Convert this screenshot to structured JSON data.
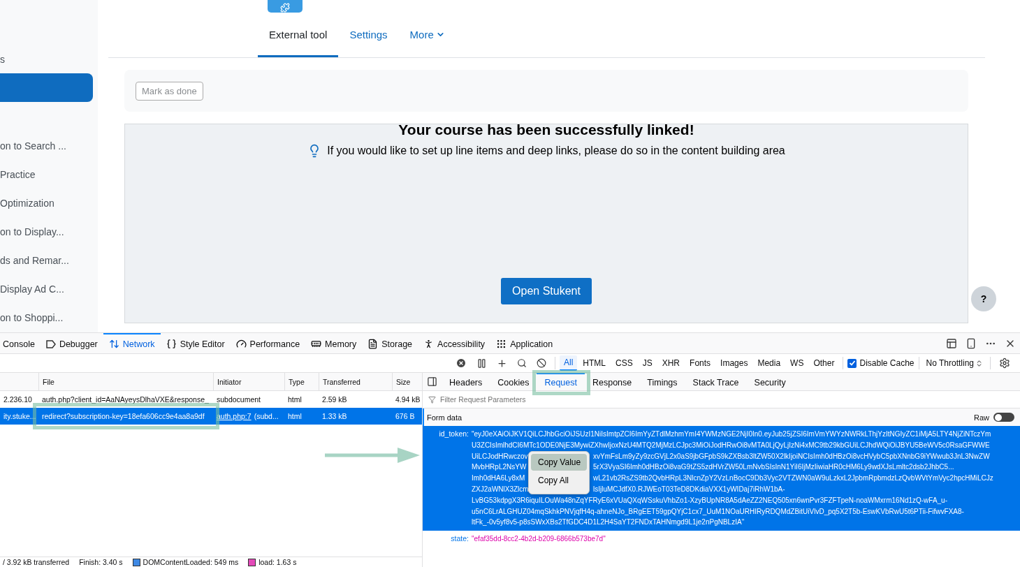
{
  "sidebar": {
    "items": [
      {
        "label": "s",
        "selected": false
      },
      {
        "selected": true
      },
      {
        "label": "on to Search ...",
        "selected": false
      },
      {
        "label": "Practice",
        "selected": false
      },
      {
        "label": "Optimization",
        "selected": false
      },
      {
        "label": "on to Display...",
        "selected": false
      },
      {
        "label": "ds and Remar...",
        "selected": false
      },
      {
        "label": "Display Ad C...",
        "selected": false
      },
      {
        "label": "on to Shoppi...",
        "selected": false
      }
    ]
  },
  "activity_tabs": [
    {
      "label": "External tool",
      "selected": true,
      "kind": "link"
    },
    {
      "label": "Settings",
      "selected": false,
      "kind": "link"
    },
    {
      "label": "More",
      "selected": false,
      "kind": "dropdown"
    }
  ],
  "completion": {
    "button": "Mark as done"
  },
  "tool_content": {
    "title": "Your course has been successfully linked!",
    "hint": "If you would like to set up line items and deep links, please do so in the content building area",
    "button": "Open Stukent"
  },
  "help_button": "?",
  "devtools": {
    "tabs": [
      {
        "label": "Console",
        "selected": false
      },
      {
        "label": "Debugger",
        "selected": false
      },
      {
        "label": "Network",
        "selected": true
      },
      {
        "label": "Style Editor",
        "selected": false
      },
      {
        "label": "Performance",
        "selected": false
      },
      {
        "label": "Memory",
        "selected": false
      },
      {
        "label": "Storage",
        "selected": false
      },
      {
        "label": "Accessibility",
        "selected": false
      },
      {
        "label": "Application",
        "selected": false
      }
    ],
    "filters": [
      {
        "label": "All",
        "selected": true
      },
      {
        "label": "HTML",
        "selected": false
      },
      {
        "label": "CSS",
        "selected": false
      },
      {
        "label": "JS",
        "selected": false
      },
      {
        "label": "XHR",
        "selected": false
      },
      {
        "label": "Fonts",
        "selected": false
      },
      {
        "label": "Images",
        "selected": false
      },
      {
        "label": "Media",
        "selected": false
      },
      {
        "label": "WS",
        "selected": false
      },
      {
        "label": "Other",
        "selected": false
      }
    ],
    "disable_cache": {
      "label": "Disable Cache",
      "checked": true
    },
    "throttling": "No Throttling",
    "columns": [
      "File",
      "Initiator",
      "Type",
      "Transferred",
      "Size"
    ],
    "requests": [
      {
        "host": "2.236.10",
        "file": "auth.php?client_id=AaNAyeysDlhaVXE&response_",
        "initiator": "subdocument",
        "type": "html",
        "transferred": "2.59 kB",
        "size": "4.94 kB",
        "selected": false
      },
      {
        "host": "ity.stuke...",
        "file": "redirect?subscription-key=18efa606cc9e4aa8a9df",
        "initiator_link": "auth.php:7",
        "initiator": "(subd...",
        "type": "html",
        "transferred": "1.33 kB",
        "size": "676 B",
        "selected": true,
        "highlighted": true
      }
    ],
    "status": [
      {
        "text": "/ 3.92 kB transferred"
      },
      {
        "text": "Finish: 3.40 s"
      },
      {
        "text": "DOMContentLoaded: 549 ms",
        "color": "#3f89e4"
      },
      {
        "text": "load: 1.63 s",
        "color": "#e44ab9"
      }
    ],
    "detail_tabs": [
      {
        "label": "Headers",
        "selected": false,
        "highlighted": false
      },
      {
        "label": "Cookies",
        "selected": false,
        "highlighted": false
      },
      {
        "label": "Request",
        "selected": true,
        "highlighted": true
      },
      {
        "label": "Response",
        "selected": false,
        "highlighted": false
      },
      {
        "label": "Timings",
        "selected": false,
        "highlighted": false
      },
      {
        "label": "Stack Trace",
        "selected": false,
        "highlighted": false
      },
      {
        "label": "Security",
        "selected": false,
        "highlighted": false
      }
    ],
    "filter_placeholder": "Filter Request Parameters",
    "section": "Form data",
    "raw_toggle": {
      "label": "Raw",
      "on": false
    },
    "params": [
      {
        "name": "id_token:",
        "selected": true,
        "lines": [
          [
            "\"eyJ0eXAiOiJKV1QiLCJhbGciOiJSUzI1NiIsImtpZCI6ImYyZTdlMzhmYmI4YWMzNGE2NjI0In0.eyJub25jZSI6ImVmYWYzNWRkLThjYzItNGIyZC1iMjA5LTY4NjZiNTczYm"
          ],
          [
            "U3ZCIsImlhdCI6MTc1ODE0NjE3MywiZXhwIjoxNzU4MTQ2MjMzLCJpc3MiOiJodHRwOi8vMTA0LjQyLjIzNi4xMC9tb29kbGUiLCJhdWQiOiJBYU5BeWV5c0RsaGFWWE"
          ],
          [
            "UiLCJodHRwczov",
            "xvYmFsLm9yZy9zcGVjL2x0aS9jbGFpbS9kZXBsb3ltZW50X2lkIjoiNCIsImh0dHBzOi8vcHVybC5pbXNnbG9iYWwub3JnL3NwZW"
          ],
          [
            "MvbHRpL2NsYW",
            "5rX3VyaSI6Imh0dHBzOi8vaG9tZS5zdHVrZW50LmNvbSIsInN1YiI6IjMzIiwiaHR0cHM6Ly9wdXJsLmltc2dsb2JhbC5..."
          ],
          [
            "Imh0dHA6Ly8xM",
            "wL21vb2RsZS9tb2QvbHRpL3NlcnZpY2VzLnBocC9Db3Vyc2VTZWN0aW9uLzkxL2JpbmRpbmdzLzQvbWVtYmVyc2hpcHMiLCJz"
          ],
          [
            "ZXJ2aWNlX3Zlcm",
            "lsIjluMCJdfX0.RJWEoT03TeD8DKdiaVXX1yWIDaj7iRhW1bA-"
          ],
          [
            "LvBG53kdpgX3R6iquILOuWa48nZqYFRyE6xVUaQXqWSskuVhbZo1-XzyBUpNR8A5dAeZZ2NEQ505xn6wnPvr3FZFTpeN-noaWMxrm16Nd1zQ-wFA_u-"
          ],
          [
            "u5nC6LrALGHUZ04mqSkhkPNVjqfH4q-ahneNJo_BRgEET59gpQYjC1cx7_UuM1NOaURHIRyRDQMdZBitUiVlvD_pq5X2T5b-EswKVbRwU5t6PTii-FifwvFXA8-"
          ],
          [
            "ltFk_-0v5yf8v5-p8sSWxXBs2TfGDC4D1L2H4SaYT2FNDxTAHNmgd9L1je2nPgNBLzIA\""
          ]
        ]
      },
      {
        "name": "state:",
        "selected": false,
        "lines": [
          [
            "\"efaf35dd-8cc2-4b2d-b209-6866b573be7d\""
          ]
        ]
      }
    ],
    "context_menu": [
      {
        "label": "Copy Value",
        "selected": true
      },
      {
        "label": "Copy All",
        "selected": false
      }
    ]
  }
}
